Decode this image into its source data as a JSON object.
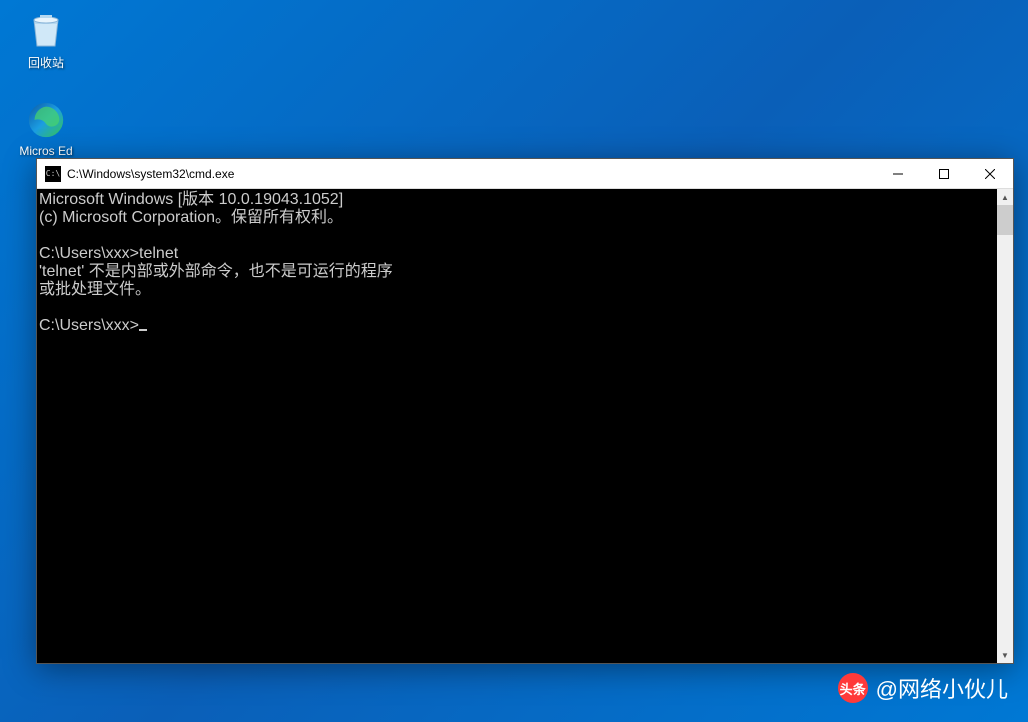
{
  "desktop": {
    "icons": [
      {
        "name": "recycle-bin",
        "label": "回收站"
      },
      {
        "name": "edge",
        "label": "Micros Ed"
      }
    ]
  },
  "window": {
    "title": "C:\\Windows\\system32\\cmd.exe",
    "terminal": {
      "line1": "Microsoft Windows [版本 10.0.19043.1052]",
      "line2": "(c) Microsoft Corporation。保留所有权利。",
      "blank1": "",
      "line3": "C:\\Users\\xxx>telnet",
      "line4": "'telnet' 不是内部或外部命令，也不是可运行的程序",
      "line5": "或批处理文件。",
      "blank2": "",
      "line6": "C:\\Users\\xxx>"
    }
  },
  "watermark": {
    "logo_text": "头条",
    "label": "@网络小伙儿"
  }
}
